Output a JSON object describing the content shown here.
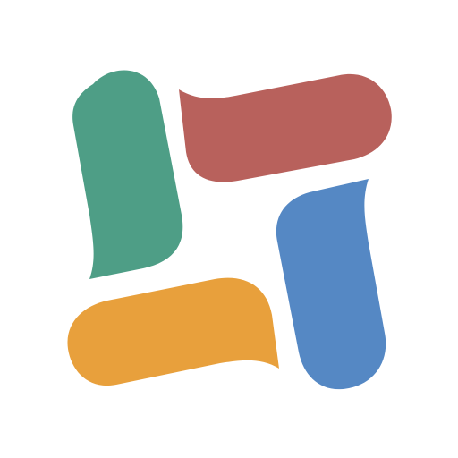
{
  "logo": {
    "icon": "four-speech-bubbles-pinwheel-icon",
    "background": "#ffffff",
    "colors": {
      "green": "#4e9e86",
      "red": "#b8615c",
      "blue": "#5588c4",
      "orange": "#e8a03c"
    }
  }
}
